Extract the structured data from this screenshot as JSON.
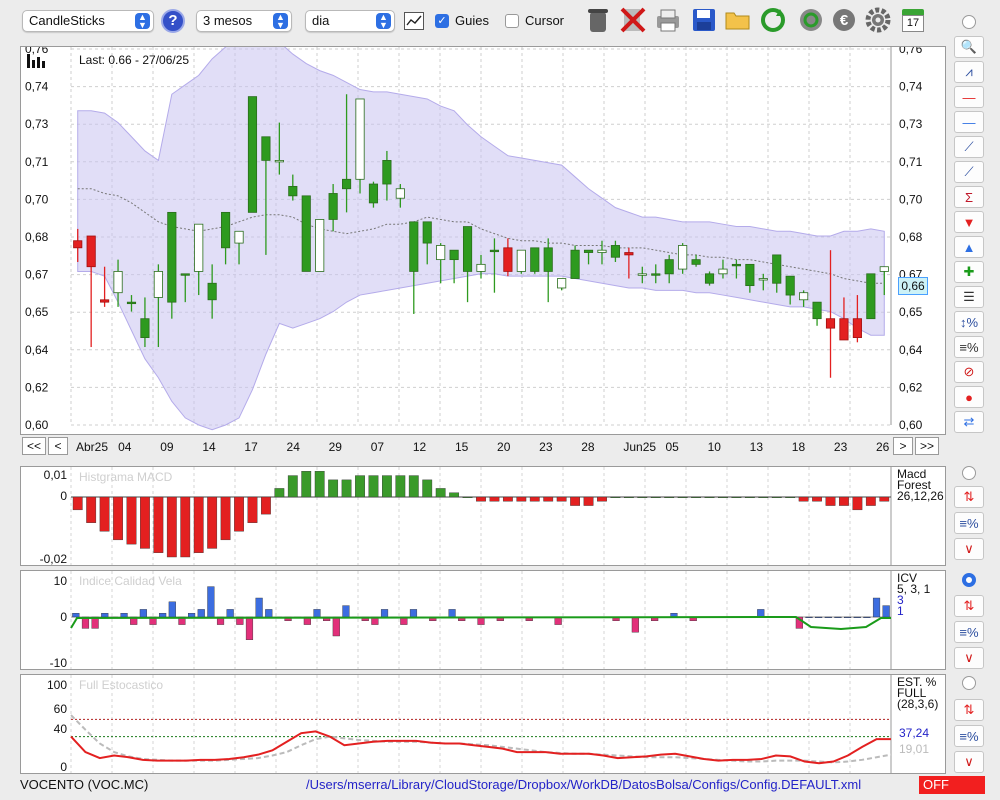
{
  "toolbar": {
    "chart_type": "CandleSticks",
    "period": "3 mesos",
    "interval": "dia",
    "guides_label": "Guies",
    "guides_checked": true,
    "cursor_label": "Cursor",
    "cursor_checked": false,
    "calendar_day": "17",
    "icons": [
      "help-icon",
      "chart-screen-icon",
      "trash-icon",
      "delete-icon",
      "print-icon",
      "save-icon",
      "folder-icon",
      "refresh-icon",
      "update-icon",
      "euro-icon",
      "gear-icon",
      "calendar-icon"
    ]
  },
  "main_chart": {
    "last_label": "Last: 0.66 - 27/06/25",
    "current_price_label": "0,66",
    "y_ticks": [
      "0,76",
      "0,74",
      "0,73",
      "0,71",
      "0,70",
      "0,68",
      "0,67",
      "0,65",
      "0,64",
      "0,62",
      "0,60"
    ],
    "nav": {
      "first": "<<",
      "prev": "<",
      "next": ">",
      "last": ">>"
    },
    "x_ticks": [
      "Abr25",
      "04",
      "09",
      "14",
      "17",
      "24",
      "29",
      "07",
      "12",
      "15",
      "20",
      "23",
      "28",
      "Jun25",
      "05",
      "10",
      "13",
      "18",
      "23",
      "26"
    ]
  },
  "chart_data": [
    {
      "type": "candlestick",
      "ylim": [
        0.6,
        0.76
      ],
      "candles": [
        {
          "o": 0.678,
          "h": 0.683,
          "l": 0.669,
          "c": 0.675
        },
        {
          "o": 0.68,
          "h": 0.68,
          "l": 0.633,
          "c": 0.667
        },
        {
          "o": 0.653,
          "h": 0.667,
          "l": 0.65,
          "c": 0.652
        },
        {
          "o": 0.656,
          "h": 0.67,
          "l": 0.65,
          "c": 0.665
        },
        {
          "o": 0.652,
          "h": 0.655,
          "l": 0.648,
          "c": 0.652
        },
        {
          "o": 0.637,
          "h": 0.654,
          "l": 0.633,
          "c": 0.645
        },
        {
          "o": 0.654,
          "h": 0.668,
          "l": 0.633,
          "c": 0.665
        },
        {
          "o": 0.652,
          "h": 0.69,
          "l": 0.645,
          "c": 0.69
        },
        {
          "o": 0.664,
          "h": 0.664,
          "l": 0.652,
          "c": 0.664
        },
        {
          "o": 0.665,
          "h": 0.685,
          "l": 0.655,
          "c": 0.685
        },
        {
          "o": 0.653,
          "h": 0.668,
          "l": 0.645,
          "c": 0.66
        },
        {
          "o": 0.675,
          "h": 0.69,
          "l": 0.668,
          "c": 0.69
        },
        {
          "o": 0.677,
          "h": 0.682,
          "l": 0.668,
          "c": 0.682
        },
        {
          "o": 0.69,
          "h": 0.739,
          "l": 0.69,
          "c": 0.739
        },
        {
          "o": 0.712,
          "h": 0.722,
          "l": 0.672,
          "c": 0.722
        },
        {
          "o": 0.712,
          "h": 0.728,
          "l": 0.706,
          "c": 0.712
        },
        {
          "o": 0.697,
          "h": 0.706,
          "l": 0.695,
          "c": 0.701
        },
        {
          "o": 0.665,
          "h": 0.697,
          "l": 0.665,
          "c": 0.697
        },
        {
          "o": 0.665,
          "h": 0.687,
          "l": 0.665,
          "c": 0.687
        },
        {
          "o": 0.687,
          "h": 0.702,
          "l": 0.682,
          "c": 0.698
        },
        {
          "o": 0.7,
          "h": 0.74,
          "l": 0.69,
          "c": 0.704
        },
        {
          "o": 0.704,
          "h": 0.738,
          "l": 0.698,
          "c": 0.738
        },
        {
          "o": 0.694,
          "h": 0.703,
          "l": 0.692,
          "c": 0.702
        },
        {
          "o": 0.702,
          "h": 0.716,
          "l": 0.695,
          "c": 0.712
        },
        {
          "o": 0.696,
          "h": 0.702,
          "l": 0.692,
          "c": 0.7
        },
        {
          "o": 0.665,
          "h": 0.686,
          "l": 0.647,
          "c": 0.686
        },
        {
          "o": 0.677,
          "h": 0.686,
          "l": 0.668,
          "c": 0.686
        },
        {
          "o": 0.67,
          "h": 0.677,
          "l": 0.66,
          "c": 0.676
        },
        {
          "o": 0.67,
          "h": 0.674,
          "l": 0.66,
          "c": 0.674
        },
        {
          "o": 0.665,
          "h": 0.684,
          "l": 0.652,
          "c": 0.684
        },
        {
          "o": 0.665,
          "h": 0.672,
          "l": 0.662,
          "c": 0.668
        },
        {
          "o": 0.674,
          "h": 0.679,
          "l": 0.656,
          "c": 0.674
        },
        {
          "o": 0.675,
          "h": 0.679,
          "l": 0.663,
          "c": 0.665
        },
        {
          "o": 0.665,
          "h": 0.674,
          "l": 0.664,
          "c": 0.674
        },
        {
          "o": 0.665,
          "h": 0.675,
          "l": 0.664,
          "c": 0.675
        },
        {
          "o": 0.665,
          "h": 0.679,
          "l": 0.652,
          "c": 0.675
        },
        {
          "o": 0.658,
          "h": 0.662,
          "l": 0.657,
          "c": 0.662
        },
        {
          "o": 0.662,
          "h": 0.676,
          "l": 0.662,
          "c": 0.674
        },
        {
          "o": 0.673,
          "h": 0.674,
          "l": 0.668,
          "c": 0.674
        },
        {
          "o": 0.673,
          "h": 0.678,
          "l": 0.668,
          "c": 0.674
        },
        {
          "o": 0.671,
          "h": 0.678,
          "l": 0.669,
          "c": 0.676
        },
        {
          "o": 0.673,
          "h": 0.675,
          "l": 0.662,
          "c": 0.672
        },
        {
          "o": 0.664,
          "h": 0.667,
          "l": 0.66,
          "c": 0.664
        },
        {
          "o": 0.664,
          "h": 0.668,
          "l": 0.66,
          "c": 0.664
        },
        {
          "o": 0.664,
          "h": 0.672,
          "l": 0.66,
          "c": 0.67
        },
        {
          "o": 0.666,
          "h": 0.677,
          "l": 0.664,
          "c": 0.676
        },
        {
          "o": 0.668,
          "h": 0.672,
          "l": 0.667,
          "c": 0.67
        },
        {
          "o": 0.66,
          "h": 0.665,
          "l": 0.659,
          "c": 0.664
        },
        {
          "o": 0.664,
          "h": 0.67,
          "l": 0.662,
          "c": 0.666
        },
        {
          "o": 0.668,
          "h": 0.67,
          "l": 0.662,
          "c": 0.668
        },
        {
          "o": 0.659,
          "h": 0.668,
          "l": 0.656,
          "c": 0.668
        },
        {
          "o": 0.662,
          "h": 0.664,
          "l": 0.657,
          "c": 0.662
        },
        {
          "o": 0.66,
          "h": 0.672,
          "l": 0.656,
          "c": 0.672
        },
        {
          "o": 0.655,
          "h": 0.663,
          "l": 0.651,
          "c": 0.663
        },
        {
          "o": 0.653,
          "h": 0.657,
          "l": 0.65,
          "c": 0.656
        },
        {
          "o": 0.645,
          "h": 0.652,
          "l": 0.642,
          "c": 0.652
        },
        {
          "o": 0.645,
          "h": 0.674,
          "l": 0.62,
          "c": 0.641
        },
        {
          "o": 0.645,
          "h": 0.654,
          "l": 0.636,
          "c": 0.636
        },
        {
          "o": 0.645,
          "h": 0.655,
          "l": 0.635,
          "c": 0.637
        },
        {
          "o": 0.645,
          "h": 0.664,
          "l": 0.645,
          "c": 0.664
        },
        {
          "o": 0.665,
          "h": 0.667,
          "l": 0.655,
          "c": 0.667
        }
      ],
      "bollinger_upper": [
        0.733,
        0.733,
        0.732,
        0.728,
        0.722,
        0.716,
        0.712,
        0.74,
        0.744,
        0.748,
        0.755,
        0.76,
        0.764,
        0.766,
        0.766,
        0.762,
        0.757,
        0.753,
        0.75,
        0.748,
        0.745,
        0.742,
        0.741,
        0.741,
        0.74,
        0.739,
        0.738,
        0.735,
        0.733,
        0.727,
        0.722,
        0.718,
        0.714,
        0.713,
        0.712,
        0.711,
        0.71,
        0.705,
        0.7,
        0.696,
        0.692,
        0.69,
        0.688,
        0.688,
        0.687,
        0.686,
        0.686,
        0.686,
        0.685,
        0.684,
        0.684,
        0.683,
        0.682,
        0.682,
        0.681,
        0.68,
        0.68,
        0.682,
        0.682,
        0.683,
        0.682
      ],
      "bollinger_lower": [
        0.665,
        0.665,
        0.663,
        0.652,
        0.64,
        0.628,
        0.62,
        0.61,
        0.603,
        0.6,
        0.598,
        0.6,
        0.603,
        0.615,
        0.63,
        0.643,
        0.641,
        0.643,
        0.645,
        0.648,
        0.652,
        0.655,
        0.656,
        0.657,
        0.658,
        0.659,
        0.66,
        0.661,
        0.662,
        0.663,
        0.664,
        0.664,
        0.663,
        0.663,
        0.663,
        0.663,
        0.663,
        0.662,
        0.661,
        0.66,
        0.659,
        0.658,
        0.658,
        0.657,
        0.657,
        0.657,
        0.656,
        0.656,
        0.655,
        0.654,
        0.653,
        0.652,
        0.651,
        0.65,
        0.65,
        0.649,
        0.648,
        0.645,
        0.641,
        0.638,
        0.638
      ],
      "moving_average": [
        0.7,
        0.7,
        0.698,
        0.697,
        0.694,
        0.69,
        0.686,
        0.684,
        0.683,
        0.682,
        0.683,
        0.684,
        0.686,
        0.688,
        0.689,
        0.689,
        0.688,
        0.685,
        0.683,
        0.682,
        0.681,
        0.682,
        0.683,
        0.685,
        0.685,
        0.686,
        0.688,
        0.687,
        0.686,
        0.686,
        0.683,
        0.681,
        0.679,
        0.678,
        0.678,
        0.677,
        0.677,
        0.676,
        0.676,
        0.676,
        0.675,
        0.675,
        0.675,
        0.674,
        0.673,
        0.672,
        0.672,
        0.671,
        0.671,
        0.67,
        0.67,
        0.669,
        0.668,
        0.667,
        0.666,
        0.665,
        0.664,
        0.662,
        0.661,
        0.66,
        0.66
      ]
    },
    {
      "type": "bar",
      "title": "Histgrama MACD",
      "y_ticks": [
        "0,01",
        "0",
        "-0,02"
      ],
      "legend": [
        "Macd",
        "Forest",
        "26,12,26"
      ],
      "values": [
        -0.003,
        -0.006,
        -0.008,
        -0.01,
        -0.011,
        -0.012,
        -0.013,
        -0.014,
        -0.014,
        -0.013,
        -0.012,
        -0.01,
        -0.008,
        -0.006,
        -0.004,
        0.002,
        0.005,
        0.006,
        0.006,
        0.004,
        0.004,
        0.005,
        0.005,
        0.005,
        0.005,
        0.005,
        0.004,
        0.002,
        0.001,
        0.0,
        -0.001,
        -0.001,
        -0.001,
        -0.001,
        -0.001,
        -0.001,
        -0.001,
        -0.002,
        -0.002,
        -0.001,
        0.0,
        0.0,
        0.0,
        0.0,
        0.0,
        0.0,
        0.0,
        0.0,
        0.0,
        0.0,
        0.0,
        0.0,
        0.0,
        0.0,
        -0.001,
        -0.001,
        -0.002,
        -0.002,
        -0.003,
        -0.002,
        -0.001
      ]
    },
    {
      "type": "bar",
      "title": "Indice Calidad Vela",
      "y_ticks": [
        "10",
        "0",
        "-10"
      ],
      "legend": [
        "ICV",
        "5, 3, 1",
        "3",
        "1"
      ],
      "values": [
        1,
        -3,
        -3,
        1,
        0,
        1,
        -2,
        2,
        -2,
        1,
        4,
        -2,
        1,
        2,
        8,
        -2,
        2,
        -2,
        -6,
        5,
        2,
        0,
        -1,
        0,
        -2,
        2,
        -1,
        -5,
        3,
        0,
        -1,
        -2,
        2,
        0,
        -2,
        2,
        0,
        -1,
        0,
        2,
        -1,
        0,
        -2,
        0,
        -1,
        0,
        0,
        -1,
        0,
        0,
        -2,
        0,
        0,
        0,
        0,
        0,
        -1,
        0,
        -4,
        0,
        -1,
        0,
        1,
        0,
        -1,
        0,
        0,
        0,
        0,
        0,
        0,
        2,
        0,
        0,
        0,
        -3,
        0,
        0,
        0,
        0,
        0,
        0,
        0,
        5,
        3
      ]
    },
    {
      "type": "line",
      "title": "Full Estocastico",
      "y_ticks": [
        "100",
        "60",
        "40",
        "0"
      ],
      "legend": [
        "EST. %",
        "FULL",
        "(28,3,6)",
        "37,24",
        "19,01"
      ],
      "k_values": [
        40,
        22,
        15,
        18,
        16,
        13,
        12,
        12,
        12,
        13,
        13,
        14,
        16,
        19,
        24,
        34,
        44,
        46,
        40,
        30,
        32,
        34,
        35,
        35,
        35,
        33,
        32,
        32,
        30,
        28,
        26,
        22,
        22,
        22,
        20,
        20,
        20,
        18,
        15,
        16,
        17,
        19,
        20,
        17,
        14,
        12,
        13,
        13,
        14,
        18,
        17,
        11,
        9,
        11,
        18,
        28,
        37,
        37
      ],
      "d_values": [
        65,
        48,
        32,
        22,
        17,
        14,
        13,
        12,
        12,
        12,
        12,
        13,
        14,
        15,
        18,
        22,
        30,
        37,
        40,
        38,
        36,
        35,
        34,
        34,
        34,
        33,
        32,
        32,
        31,
        30,
        28,
        26,
        24,
        22,
        21,
        20,
        20,
        19,
        18,
        17,
        16,
        16,
        16,
        15,
        14,
        13,
        12,
        11,
        11,
        12,
        12,
        12,
        11,
        10,
        11,
        13,
        16,
        19
      ]
    }
  ],
  "right_tools": [
    "zoom-icon",
    "indicator-icon",
    "horizontal-line-red-icon",
    "horizontal-line-blue-icon",
    "trendline-dotted-icon",
    "trendline-icon",
    "sigma-trend-icon",
    "arrow-down-red-icon",
    "arrow-up-blue-icon",
    "plus-arrows-icon",
    "list-icon",
    "vertical-percent-icon",
    "horizontal-percent-icon",
    "stop-icon",
    "record-icon",
    "swap-icon"
  ],
  "status": {
    "ticker": "VOCENTO (VOC.MC)",
    "path": "/Users/mserra/Library/CloudStorage/Dropbox/WorkDB/DatosBolsa/Configs/Config.DEFAULT.xml",
    "state": "OFF"
  },
  "colors": {
    "up": "#2e9a1f",
    "down": "#e32020",
    "band": "#c9c3f0",
    "accent": "#2d6fe3",
    "macd_up": "#3a9a2a",
    "icv_up": "#3c6de0",
    "icv_down": "#e2307a",
    "stoch_k": "#e32020",
    "stoch_d": "#bbbbbb"
  }
}
